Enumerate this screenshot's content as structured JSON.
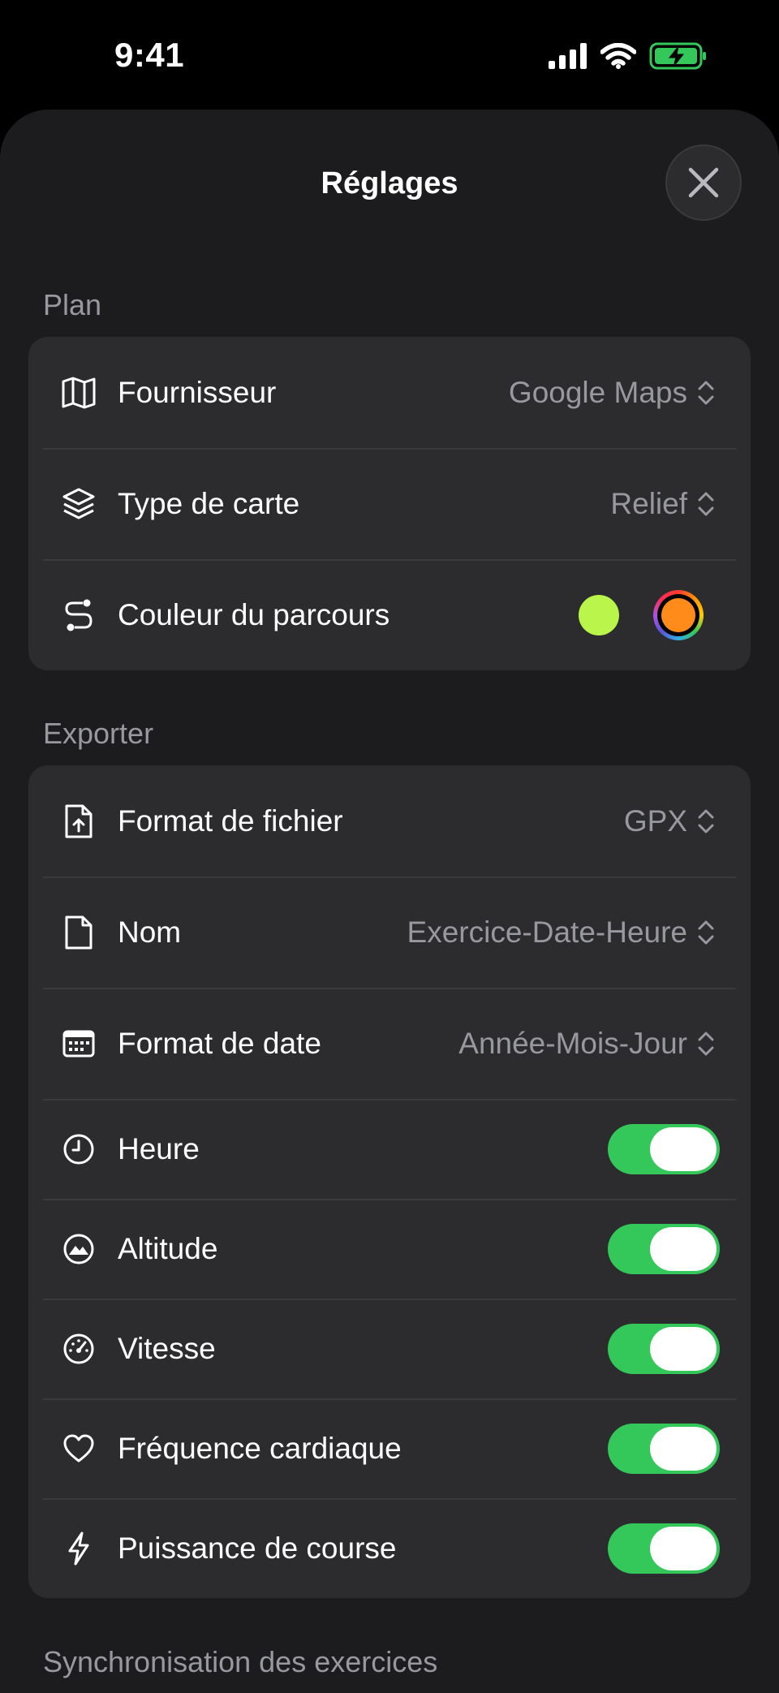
{
  "status_bar": {
    "time": "9:41",
    "icons": [
      "cellular-signal-icon",
      "wifi-icon",
      "battery-charging-icon"
    ]
  },
  "sheet": {
    "title": "Réglages",
    "close_icon": "close-icon"
  },
  "sections": {
    "plan": {
      "label": "Plan",
      "rows": {
        "provider": {
          "icon": "map-icon",
          "label": "Fournisseur",
          "value": "Google Maps"
        },
        "map_type": {
          "icon": "layers-icon",
          "label": "Type de carte",
          "value": "Relief"
        },
        "route_color": {
          "icon": "route-icon",
          "label": "Couleur du parcours",
          "colors": [
            "#b9f54a",
            "#ff8c1a"
          ]
        }
      }
    },
    "export": {
      "label": "Exporter",
      "rows": {
        "file_format": {
          "icon": "file-export-icon",
          "label": "Format de fichier",
          "value": "GPX"
        },
        "name": {
          "icon": "document-icon",
          "label": "Nom",
          "value": "Exercice-Date-Heure"
        },
        "date_format": {
          "icon": "calendar-icon",
          "label": "Format de date",
          "value": "Année-Mois-Jour"
        },
        "time": {
          "icon": "clock-icon",
          "label": "Heure",
          "on": true
        },
        "altitude": {
          "icon": "mountain-icon",
          "label": "Altitude",
          "on": true
        },
        "speed": {
          "icon": "speedometer-icon",
          "label": "Vitesse",
          "on": true
        },
        "heart_rate": {
          "icon": "heart-icon",
          "label": "Fréquence cardiaque",
          "on": true
        },
        "running_power": {
          "icon": "bolt-icon",
          "label": "Puissance de course",
          "on": true
        }
      }
    },
    "sync": {
      "label": "Synchronisation des exercices"
    }
  },
  "colors": {
    "background": "#1c1c1e",
    "card": "#2c2c2e",
    "toggle_on": "#34c759",
    "secondary_text": "#98989f"
  }
}
